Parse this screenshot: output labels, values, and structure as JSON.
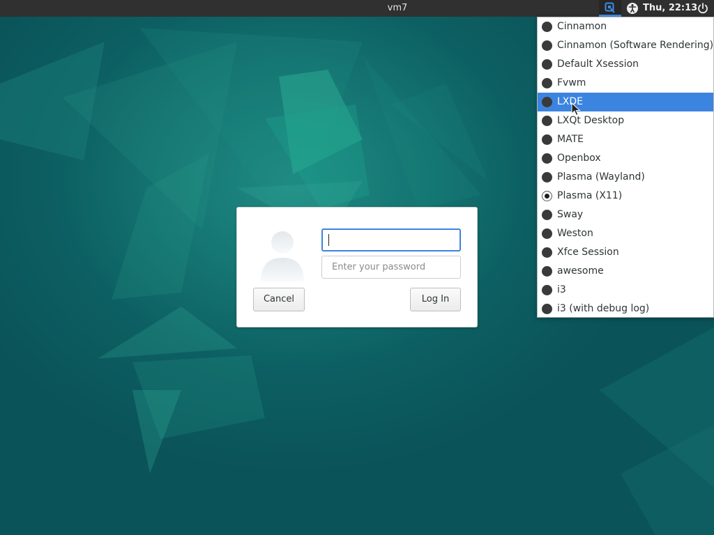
{
  "top_panel": {
    "hostname": "vm7",
    "clock": "Thu, 22:13",
    "icons": [
      "session-selector-icon",
      "accessibility-icon",
      "power-icon"
    ]
  },
  "session_menu": {
    "selected": "Plasma (X11)",
    "highlighted": "LXDE",
    "items": [
      {
        "label": "Cinnamon"
      },
      {
        "label": "Cinnamon (Software Rendering)"
      },
      {
        "label": "Default Xsession"
      },
      {
        "label": "Fvwm"
      },
      {
        "label": "LXDE"
      },
      {
        "label": "LXQt Desktop"
      },
      {
        "label": "MATE"
      },
      {
        "label": "Openbox"
      },
      {
        "label": "Plasma (Wayland)"
      },
      {
        "label": "Plasma (X11)"
      },
      {
        "label": "Sway"
      },
      {
        "label": "Weston"
      },
      {
        "label": "Xfce Session"
      },
      {
        "label": "awesome"
      },
      {
        "label": "i3"
      },
      {
        "label": "i3 (with debug log)"
      }
    ]
  },
  "login_dialog": {
    "username_value": "",
    "password_placeholder": "Enter your password",
    "cancel_label": "Cancel",
    "login_label": "Log In"
  },
  "colors": {
    "accent": "#3b84e0",
    "panel": "#303030",
    "desktop": "#0c5f62"
  }
}
